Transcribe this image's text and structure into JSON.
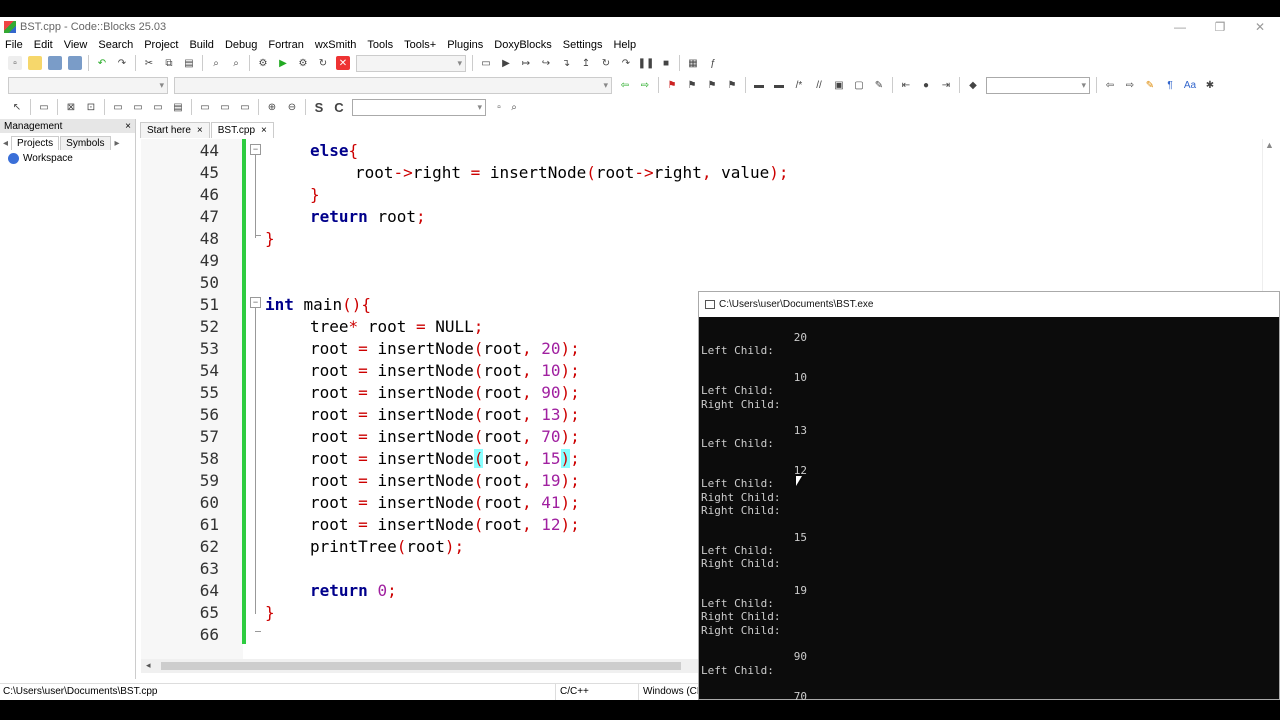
{
  "window": {
    "title": "BST.cpp - Code::Blocks 25.03",
    "minimize": "—",
    "restore": "❐",
    "close": "✕"
  },
  "menu": [
    "File",
    "Edit",
    "View",
    "Search",
    "Project",
    "Build",
    "Debug",
    "Fortran",
    "wxSmith",
    "Tools",
    "Tools+",
    "Plugins",
    "DoxyBlocks",
    "Settings",
    "Help"
  ],
  "management": {
    "title": "Management",
    "close": "×",
    "tabs": [
      "Projects",
      "Symbols"
    ],
    "workspace_label": "Workspace"
  },
  "editor_tabs": [
    {
      "label": "Start here",
      "close": "×"
    },
    {
      "label": "BST.cpp",
      "close": "×"
    }
  ],
  "code_lines": [
    {
      "n": "44",
      "text": "else{"
    },
    {
      "n": "45",
      "text": "root->right = insertNode(root->right, value);"
    },
    {
      "n": "46",
      "text": "}"
    },
    {
      "n": "47",
      "text": "return root;"
    },
    {
      "n": "48",
      "text": "}"
    },
    {
      "n": "49",
      "text": ""
    },
    {
      "n": "50",
      "text": ""
    },
    {
      "n": "51",
      "text": "int main(){"
    },
    {
      "n": "52",
      "text": "tree* root = NULL;"
    },
    {
      "n": "53",
      "text": "root = insertNode(root, 20);"
    },
    {
      "n": "54",
      "text": "root = insertNode(root, 10);"
    },
    {
      "n": "55",
      "text": "root = insertNode(root, 90);"
    },
    {
      "n": "56",
      "text": "root = insertNode(root, 13);"
    },
    {
      "n": "57",
      "text": "root = insertNode(root, 70);"
    },
    {
      "n": "58",
      "text": "root = insertNode(root, 15);"
    },
    {
      "n": "59",
      "text": "root = insertNode(root, 19);"
    },
    {
      "n": "60",
      "text": "root = insertNode(root, 41);"
    },
    {
      "n": "61",
      "text": "root = insertNode(root, 12);"
    },
    {
      "n": "62",
      "text": "printTree(root);"
    },
    {
      "n": "63",
      "text": ""
    },
    {
      "n": "64",
      "text": "return 0;"
    },
    {
      "n": "65",
      "text": "}"
    },
    {
      "n": "66",
      "text": ""
    }
  ],
  "statusbar": {
    "path": "C:\\Users\\user\\Documents\\BST.cpp",
    "lang": "C/C++",
    "eol": "Windows (CR"
  },
  "console": {
    "title": "C:\\Users\\user\\Documents\\BST.exe",
    "lines": [
      {
        "t": "              20"
      },
      {
        "t": "Left Child:"
      },
      {
        "t": ""
      },
      {
        "t": "              10"
      },
      {
        "t": "Left Child:"
      },
      {
        "t": "Right Child:"
      },
      {
        "t": ""
      },
      {
        "t": "              13"
      },
      {
        "t": "Left Child:"
      },
      {
        "t": ""
      },
      {
        "t": "              12"
      },
      {
        "t": "Left Child:"
      },
      {
        "t": "Right Child:"
      },
      {
        "t": "Right Child:"
      },
      {
        "t": ""
      },
      {
        "t": "              15"
      },
      {
        "t": "Left Child:"
      },
      {
        "t": "Right Child:"
      },
      {
        "t": ""
      },
      {
        "t": "              19"
      },
      {
        "t": "Left Child:"
      },
      {
        "t": "Right Child:"
      },
      {
        "t": "Right Child:"
      },
      {
        "t": ""
      },
      {
        "t": "              90"
      },
      {
        "t": "Left Child:"
      },
      {
        "t": ""
      },
      {
        "t": "              70"
      }
    ]
  },
  "colors": {
    "keyword": "#00008b",
    "number": "#a020a0",
    "operator": "#c00000",
    "change_bar": "#2ecc40",
    "brace_highlight": "#88ffff"
  }
}
